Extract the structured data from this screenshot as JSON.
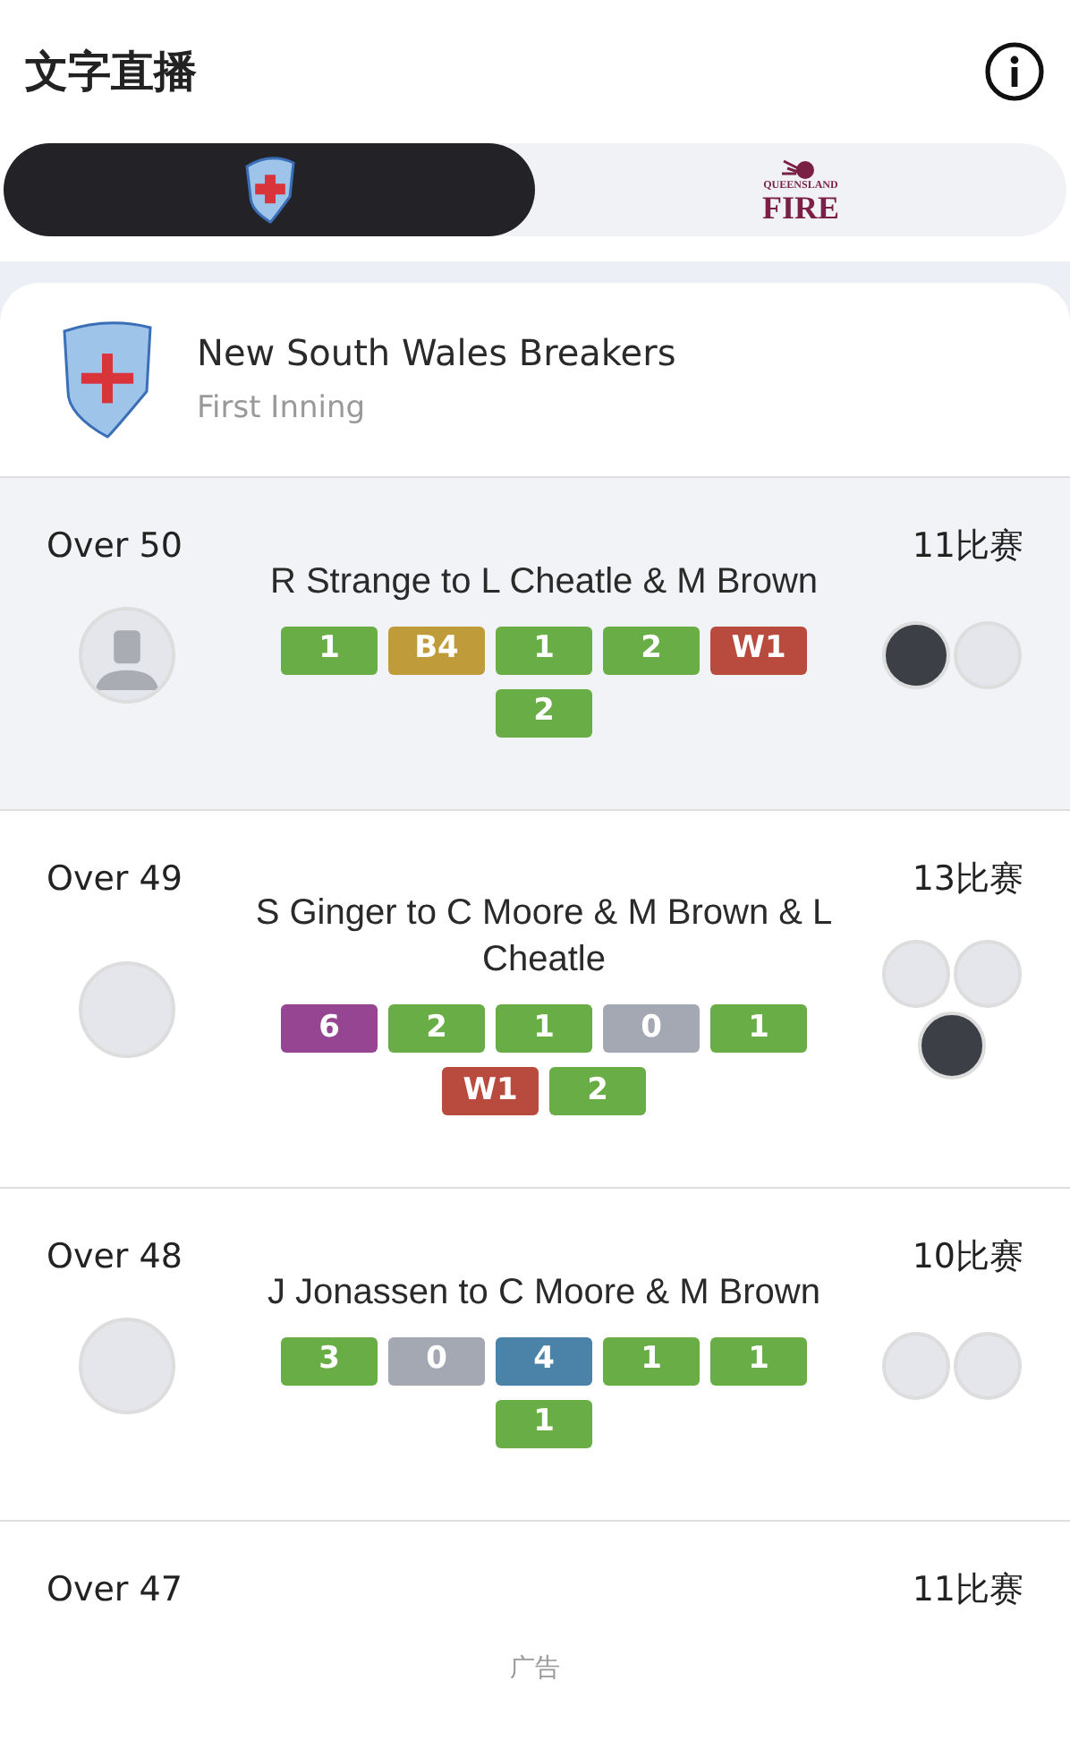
{
  "header": {
    "title": "文字直播"
  },
  "team_tabs": [
    {
      "kind": "shield",
      "selected": true
    },
    {
      "kind": "fire",
      "lines": [
        "QUEENSLAND",
        "FIRE"
      ],
      "selected": false
    }
  ],
  "innings": {
    "team": "New South Wales Breakers",
    "inning": "First Inning"
  },
  "overs": [
    {
      "over": "Over 50",
      "runs": "11比赛",
      "summary": "R Strange to L Cheatle & M Brown",
      "selected": true,
      "bowler": {
        "kind": "silhouette"
      },
      "batters": [
        {
          "kind": "photo"
        },
        {
          "kind": "photo"
        }
      ],
      "balls": [
        {
          "label": "1",
          "kind": "run"
        },
        {
          "label": "B4",
          "kind": "bye"
        },
        {
          "label": "1",
          "kind": "run"
        },
        {
          "label": "2",
          "kind": "run"
        },
        {
          "label": "W1",
          "kind": "wicket"
        },
        {
          "label": "2",
          "kind": "run"
        }
      ]
    },
    {
      "over": "Over 49",
      "runs": "13比赛",
      "summary": "S Ginger to C Moore & M Brown & L Cheatle",
      "selected": false,
      "bowler": {
        "kind": "photo"
      },
      "batters": [
        {
          "kind": "photo"
        },
        {
          "kind": "photo"
        },
        {
          "kind": "photo"
        }
      ],
      "balls": [
        {
          "label": "6",
          "kind": "six"
        },
        {
          "label": "2",
          "kind": "run"
        },
        {
          "label": "1",
          "kind": "run"
        },
        {
          "label": "0",
          "kind": "dot"
        },
        {
          "label": "1",
          "kind": "run"
        },
        {
          "label": "W1",
          "kind": "wicket"
        },
        {
          "label": "2",
          "kind": "run"
        }
      ]
    },
    {
      "over": "Over 48",
      "runs": "10比赛",
      "summary": "J Jonassen to C Moore & M Brown",
      "selected": false,
      "bowler": {
        "kind": "photo"
      },
      "batters": [
        {
          "kind": "photo"
        },
        {
          "kind": "photo"
        }
      ],
      "balls": [
        {
          "label": "3",
          "kind": "run"
        },
        {
          "label": "0",
          "kind": "dot"
        },
        {
          "label": "4",
          "kind": "four"
        },
        {
          "label": "1",
          "kind": "run"
        },
        {
          "label": "1",
          "kind": "run"
        },
        {
          "label": "1",
          "kind": "run"
        }
      ]
    },
    {
      "over": "Over 47",
      "runs": "11比赛",
      "selected": false
    }
  ],
  "ad": {
    "label": "广告"
  }
}
